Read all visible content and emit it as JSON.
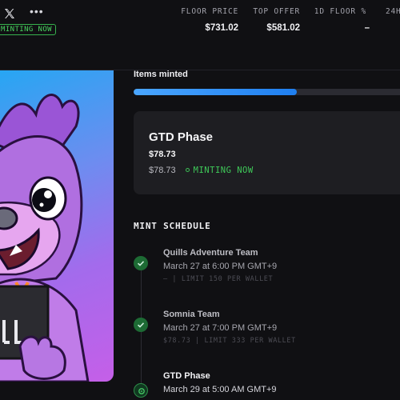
{
  "header": {
    "social_icon": "x-logo-icon",
    "more_icon": "more-horizontal-icon",
    "status_badge": "MINTING NOW",
    "stats": [
      {
        "label": "FLOOR PRICE",
        "value": "$731.02"
      },
      {
        "label": "TOP OFFER",
        "value": "$581.02"
      },
      {
        "label": "1D FLOOR %",
        "value": "–"
      },
      {
        "label": "24H",
        "value": ""
      }
    ]
  },
  "artwork": {
    "description_icon": "nft-character-artwork"
  },
  "mint": {
    "items_minted_label": "Items minted",
    "progress_fraction": 0.6
  },
  "phase_card": {
    "title": "GTD Phase",
    "price": "$78.73",
    "sub_price": "$78.73",
    "status": "MINTING NOW"
  },
  "schedule": {
    "title": "MINT SCHEDULE",
    "stages": [
      {
        "name": "Quills Adventure Team",
        "date": "March 27 at 6:00 PM GMT+9",
        "meta": "– | LIMIT 150 PER WALLET",
        "state": "complete"
      },
      {
        "name": "Somnia Team",
        "date": "March 27 at 7:00 PM GMT+9",
        "meta": "$78.73 | LIMIT 333 PER WALLET",
        "state": "complete"
      },
      {
        "name": "GTD Phase",
        "date": "March 29 at 5:00 AM GMT+9",
        "meta": "",
        "state": "current"
      }
    ]
  },
  "colors": {
    "accent_green": "#3fca59",
    "progress_blue": "#2f8ff5",
    "card_bg": "#1e1e22",
    "page_bg": "#101013"
  }
}
